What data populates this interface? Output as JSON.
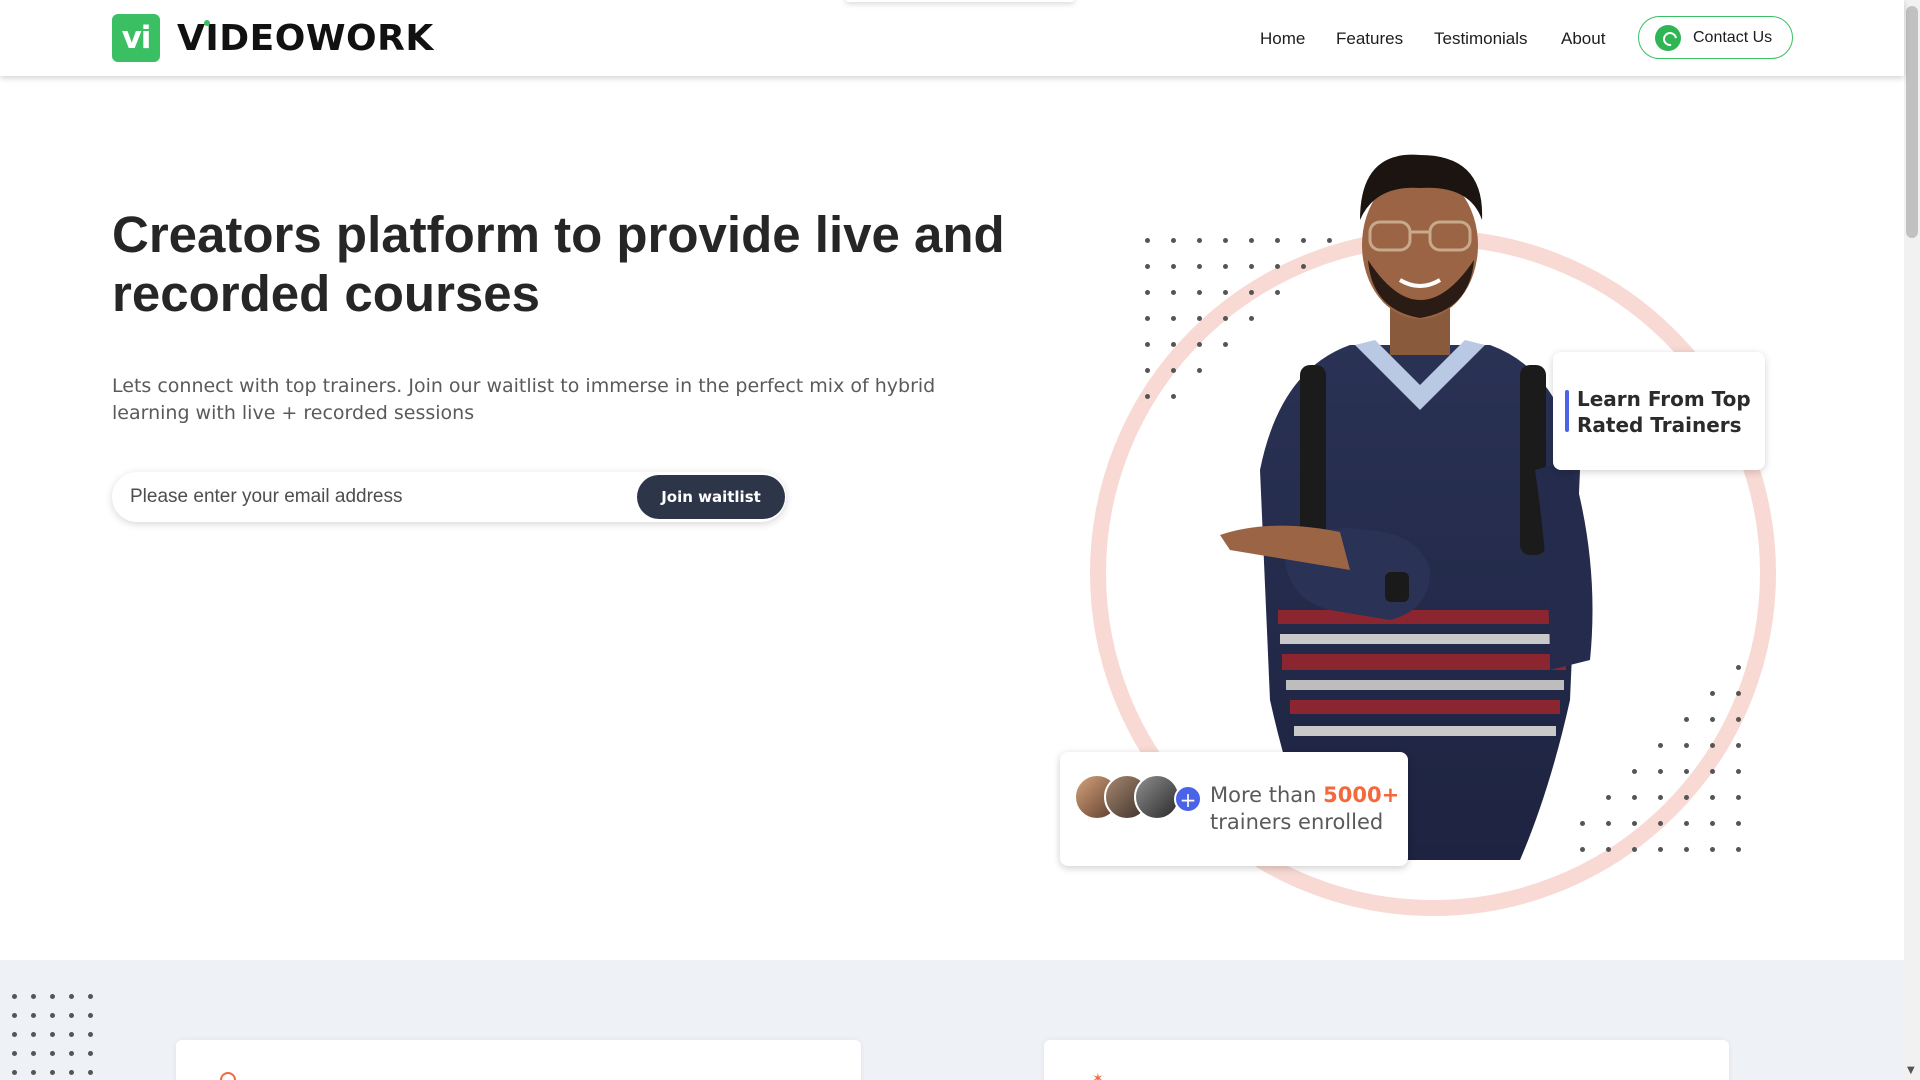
{
  "brand": {
    "mark": "vi",
    "name": "VIDEOWORK",
    "color": "#3bbf63"
  },
  "nav": {
    "items": [
      "Home",
      "Features",
      "Testimonials",
      "About"
    ],
    "contact_label": "Contact Us",
    "contact_icon": "whatsapp-icon"
  },
  "hero": {
    "title_part1": "Creators platform to provide ",
    "title_highlight1": "live",
    "title_part2": " and ",
    "title_highlight2": "recorded",
    "title_part3": " courses",
    "subtitle": "Lets connect with top trainers. Join our waitlist to immerse in the perfect mix of hybrid learning with live + recorded sessions",
    "email_placeholder": "Please enter your email address",
    "join_label": "Join waitlist"
  },
  "illustration": {
    "card_top": "Learn From Top Rated Trainers",
    "card_bottom_prefix": "More than ",
    "card_bottom_count": "5000+",
    "card_bottom_suffix": "trainers enrolled",
    "plus_symbol": "+"
  },
  "colors": {
    "accent_orange": "#f4683c",
    "accent_blue": "#4a63e8",
    "button_dark": "#2d3648",
    "ring": "#f8d9d3"
  }
}
